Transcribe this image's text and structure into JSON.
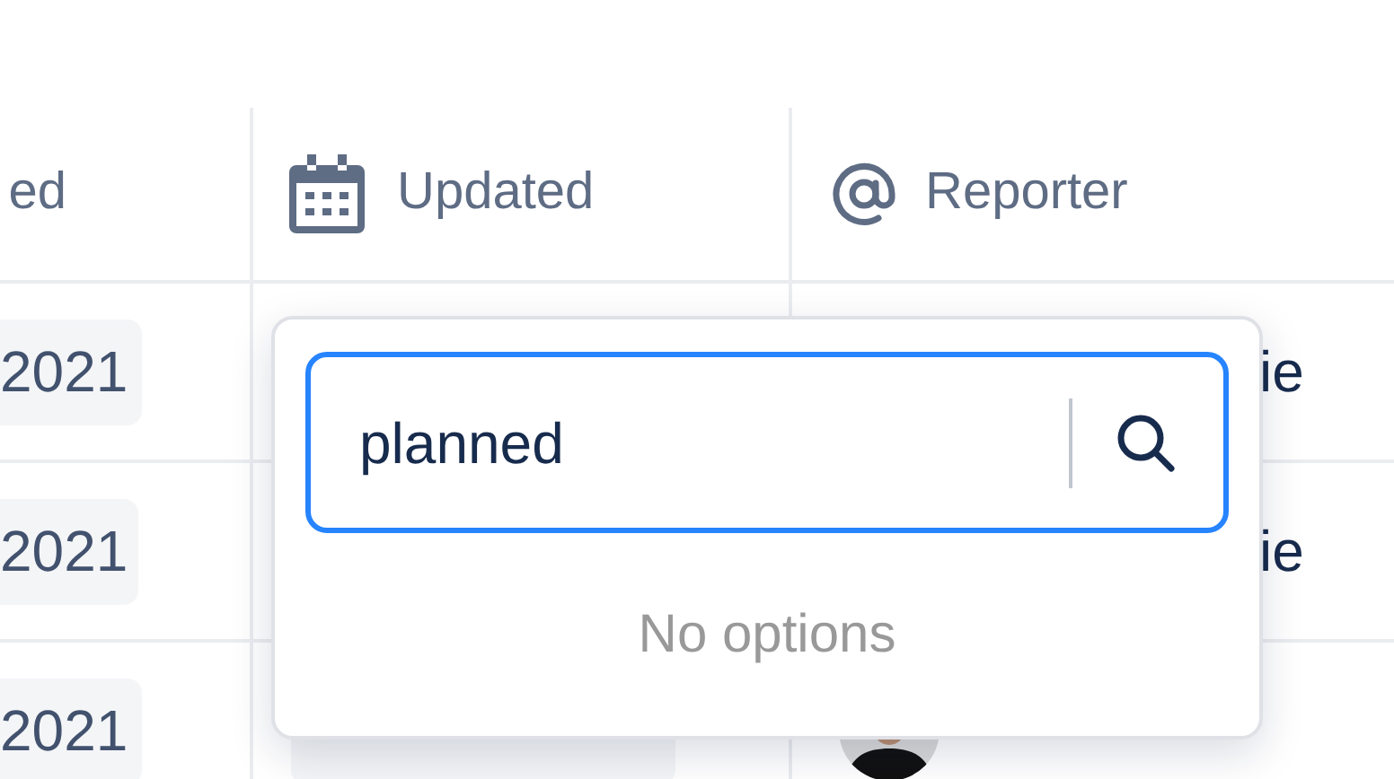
{
  "columns": [
    {
      "label": "ed",
      "kind": "none"
    },
    {
      "label": "Updated",
      "kind": "calendar"
    },
    {
      "label": "Reporter",
      "kind": "at"
    }
  ],
  "rows": [
    {
      "column_1": "2021",
      "reporter": "ie"
    },
    {
      "column_1": "2021",
      "reporter": "ie"
    },
    {
      "column_1": "2021",
      "updated_chip": true
    }
  ],
  "popover": {
    "search": {
      "value": "planned"
    },
    "message": "No options"
  }
}
